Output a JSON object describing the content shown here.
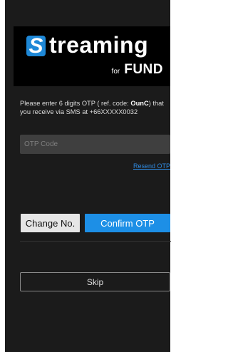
{
  "brand": {
    "logo_letter": "S",
    "logo_word": "treaming",
    "for_text": "for",
    "fund_text": "FUND"
  },
  "otp": {
    "message_before": "Please enter 6 digits OTP ( ref. code: ",
    "ref_code": "OunC",
    "message_after": ") that you receive via SMS at +66XXXXX0032",
    "placeholder": "OTP Code",
    "resend_label": "Resend OTP"
  },
  "actions": {
    "change_label": "Change No.",
    "confirm_label": "Confirm OTP",
    "skip_label": "Skip"
  },
  "colors": {
    "accent": "#1d8fe6",
    "background": "#1b1b1b",
    "header": "#000000"
  }
}
